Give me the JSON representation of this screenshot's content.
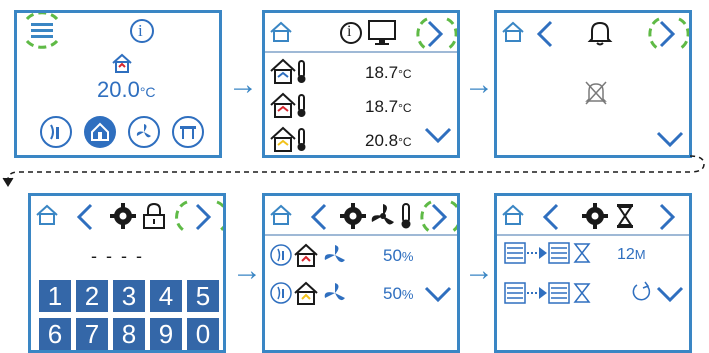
{
  "screen2": {
    "rows": [
      {
        "value": "18.7",
        "unit": "°C"
      },
      {
        "value": "18.7",
        "unit": "°C"
      },
      {
        "value": "20.8",
        "unit": "°C"
      }
    ]
  },
  "screen1": {
    "temp_value": "20.0",
    "temp_unit": "°C",
    "info_glyph": "i"
  },
  "screen2_info_glyph": "i",
  "screen4": {
    "code": "- - - -",
    "keys": [
      "1",
      "2",
      "3",
      "4",
      "5",
      "6",
      "7",
      "8",
      "9",
      "0"
    ]
  },
  "screen5": {
    "rows": [
      {
        "value": "50",
        "unit": "%"
      },
      {
        "value": "50",
        "unit": "%"
      }
    ]
  },
  "screen6": {
    "timer_value": "12",
    "timer_unit": "M"
  },
  "colors": {
    "border": "#3a86c4",
    "accent_green": "#5fba46",
    "key_bg": "#3467a8",
    "icon_blue": "#2f6fbf",
    "red": "#d9262e",
    "yellow": "#f2c21b"
  }
}
